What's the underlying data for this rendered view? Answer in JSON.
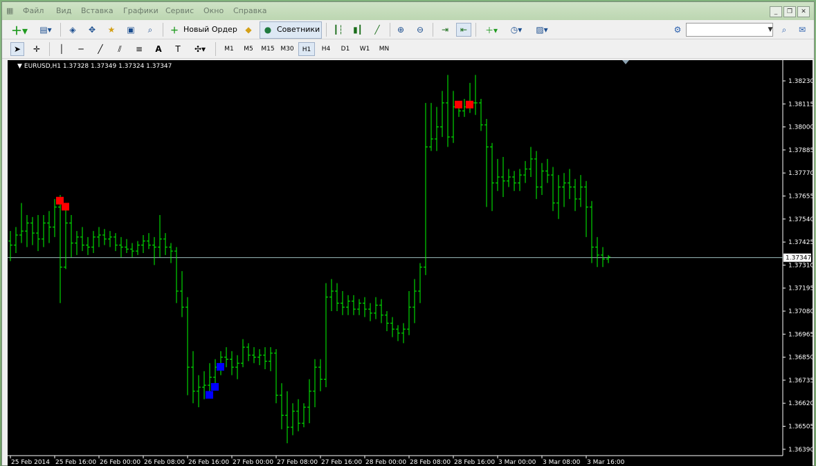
{
  "menu": [
    "Файл",
    "Вид",
    "Вставка",
    "Графики",
    "Сервис",
    "Окно",
    "Справка"
  ],
  "toolbar": {
    "new_order": "Новый Ордер",
    "experts": "Советники",
    "search_placeholder": ""
  },
  "timeframes": [
    "M1",
    "M5",
    "M15",
    "M30",
    "H1",
    "H4",
    "D1",
    "W1",
    "MN"
  ],
  "active_timeframe": "H1",
  "chart": {
    "symbol_text": "EURUSD,H1",
    "ohlc_text": "1.37328 1.37349 1.37324 1.37347",
    "current_price": "1.37347",
    "colors": {
      "bull": "#00ff00",
      "bear": "#00ff00",
      "buy_marker": "#0000ff",
      "sell_marker": "#ff0000",
      "bid_line": "#a0c0c0"
    }
  },
  "chart_data": {
    "type": "bar",
    "title": "EURUSD,H1",
    "ylim": [
      1.3633,
      1.3834
    ],
    "price_ticks": [
      "1.38230",
      "1.38115",
      "1.38000",
      "1.37885",
      "1.37770",
      "1.37655",
      "1.37540",
      "1.37425",
      "1.37310",
      "1.37195",
      "1.37080",
      "1.36965",
      "1.36850",
      "1.36735",
      "1.36620",
      "1.36505",
      "1.36390"
    ],
    "time_ticks": [
      "25 Feb 2014",
      "25 Feb 16:00",
      "26 Feb 00:00",
      "26 Feb 08:00",
      "26 Feb 16:00",
      "27 Feb 00:00",
      "27 Feb 08:00",
      "27 Feb 16:00",
      "28 Feb 00:00",
      "28 Feb 08:00",
      "28 Feb 16:00",
      "3 Mar 00:00",
      "3 Mar 08:00",
      "3 Mar 16:00"
    ],
    "bars_per_tick": 8,
    "ohlc": [
      [
        1.3743,
        1.3748,
        1.3733,
        1.3741
      ],
      [
        1.3741,
        1.375,
        1.3737,
        1.3746
      ],
      [
        1.3746,
        1.3762,
        1.3742,
        1.3748
      ],
      [
        1.3748,
        1.3756,
        1.374,
        1.3752
      ],
      [
        1.3752,
        1.3755,
        1.3741,
        1.3747
      ],
      [
        1.3747,
        1.3756,
        1.3738,
        1.3744
      ],
      [
        1.3744,
        1.3756,
        1.374,
        1.3752
      ],
      [
        1.3752,
        1.3758,
        1.3742,
        1.375
      ],
      [
        1.375,
        1.3764,
        1.3745,
        1.376
      ],
      [
        1.376,
        1.3766,
        1.3712,
        1.373
      ],
      [
        1.373,
        1.376,
        1.3729,
        1.3752
      ],
      [
        1.3752,
        1.3756,
        1.3735,
        1.3742
      ],
      [
        1.3742,
        1.3748,
        1.3736,
        1.3745
      ],
      [
        1.3745,
        1.375,
        1.3738,
        1.3741
      ],
      [
        1.3741,
        1.3745,
        1.3736,
        1.374
      ],
      [
        1.374,
        1.3748,
        1.3737,
        1.3745
      ],
      [
        1.3745,
        1.375,
        1.374,
        1.3746
      ],
      [
        1.3746,
        1.3749,
        1.3741,
        1.3744
      ],
      [
        1.3744,
        1.3748,
        1.374,
        1.3745
      ],
      [
        1.3745,
        1.3747,
        1.3738,
        1.3741
      ],
      [
        1.3741,
        1.3745,
        1.3735,
        1.374
      ],
      [
        1.374,
        1.3744,
        1.3737,
        1.3739
      ],
      [
        1.3739,
        1.3742,
        1.3735,
        1.3738
      ],
      [
        1.3738,
        1.3743,
        1.3736,
        1.3741
      ],
      [
        1.3741,
        1.3746,
        1.3737,
        1.3743
      ],
      [
        1.3743,
        1.3747,
        1.3739,
        1.3741
      ],
      [
        1.3741,
        1.3745,
        1.3731,
        1.374
      ],
      [
        1.374,
        1.3756,
        1.3735,
        1.3744
      ],
      [
        1.3744,
        1.3747,
        1.3736,
        1.374
      ],
      [
        1.374,
        1.3742,
        1.3732,
        1.3738
      ],
      [
        1.3738,
        1.374,
        1.3712,
        1.3718
      ],
      [
        1.3718,
        1.3728,
        1.3705,
        1.371
      ],
      [
        1.371,
        1.3715,
        1.3666,
        1.368
      ],
      [
        1.368,
        1.3688,
        1.3662,
        1.3668
      ],
      [
        1.3668,
        1.3676,
        1.366,
        1.367
      ],
      [
        1.367,
        1.3678,
        1.3664,
        1.3671
      ],
      [
        1.3671,
        1.3682,
        1.3666,
        1.3675
      ],
      [
        1.3675,
        1.3684,
        1.367,
        1.368
      ],
      [
        1.368,
        1.3688,
        1.3676,
        1.3685
      ],
      [
        1.3685,
        1.369,
        1.368,
        1.3684
      ],
      [
        1.3684,
        1.3688,
        1.3676,
        1.368
      ],
      [
        1.368,
        1.3686,
        1.3674,
        1.3682
      ],
      [
        1.3682,
        1.3694,
        1.368,
        1.369
      ],
      [
        1.369,
        1.3692,
        1.3683,
        1.3686
      ],
      [
        1.3686,
        1.369,
        1.3682,
        1.3685
      ],
      [
        1.3685,
        1.3689,
        1.3681,
        1.3686
      ],
      [
        1.3686,
        1.369,
        1.3679,
        1.3683
      ],
      [
        1.3683,
        1.369,
        1.3678,
        1.3687
      ],
      [
        1.3687,
        1.3689,
        1.3662,
        1.3666
      ],
      [
        1.3666,
        1.3672,
        1.3649,
        1.3656
      ],
      [
        1.3656,
        1.3668,
        1.3642,
        1.365
      ],
      [
        1.365,
        1.3662,
        1.3646,
        1.3658
      ],
      [
        1.3658,
        1.3664,
        1.3648,
        1.3652
      ],
      [
        1.3652,
        1.3662,
        1.365,
        1.366
      ],
      [
        1.366,
        1.3674,
        1.3652,
        1.3668
      ],
      [
        1.3668,
        1.3684,
        1.366,
        1.368
      ],
      [
        1.368,
        1.3684,
        1.3668,
        1.3674
      ],
      [
        1.3674,
        1.3722,
        1.367,
        1.3715
      ],
      [
        1.3715,
        1.3724,
        1.3708,
        1.3718
      ],
      [
        1.3718,
        1.3722,
        1.3708,
        1.3712
      ],
      [
        1.3712,
        1.3718,
        1.3706,
        1.371
      ],
      [
        1.371,
        1.3716,
        1.3706,
        1.3713
      ],
      [
        1.3713,
        1.3716,
        1.3706,
        1.3709
      ],
      [
        1.3709,
        1.3714,
        1.3706,
        1.3712
      ],
      [
        1.3712,
        1.3715,
        1.3705,
        1.3709
      ],
      [
        1.3709,
        1.3712,
        1.3703,
        1.3707
      ],
      [
        1.3707,
        1.3715,
        1.3704,
        1.3711
      ],
      [
        1.3711,
        1.3714,
        1.3702,
        1.3706
      ],
      [
        1.3706,
        1.3708,
        1.3698,
        1.3702
      ],
      [
        1.3702,
        1.3705,
        1.3695,
        1.3699
      ],
      [
        1.3699,
        1.3701,
        1.3693,
        1.3697
      ],
      [
        1.3697,
        1.3702,
        1.3692,
        1.3699
      ],
      [
        1.3699,
        1.3718,
        1.3696,
        1.371
      ],
      [
        1.371,
        1.3724,
        1.3702,
        1.3718
      ],
      [
        1.3718,
        1.3732,
        1.3712,
        1.373
      ],
      [
        1.373,
        1.3812,
        1.3726,
        1.379
      ],
      [
        1.379,
        1.3812,
        1.3788,
        1.3794
      ],
      [
        1.3794,
        1.381,
        1.3788,
        1.38
      ],
      [
        1.38,
        1.3818,
        1.3795,
        1.3812
      ],
      [
        1.3812,
        1.3826,
        1.379,
        1.3795
      ],
      [
        1.3795,
        1.3818,
        1.3792,
        1.381
      ],
      [
        1.381,
        1.3813,
        1.3805,
        1.3808
      ],
      [
        1.3808,
        1.3814,
        1.3805,
        1.381
      ],
      [
        1.381,
        1.3822,
        1.3807,
        1.3812
      ],
      [
        1.3812,
        1.3826,
        1.3806,
        1.3812
      ],
      [
        1.3812,
        1.3814,
        1.3798,
        1.3801
      ],
      [
        1.3801,
        1.3804,
        1.376,
        1.379
      ],
      [
        1.379,
        1.3792,
        1.3758,
        1.3772
      ],
      [
        1.3772,
        1.3784,
        1.3768,
        1.3775
      ],
      [
        1.3775,
        1.3785,
        1.3765,
        1.3773
      ],
      [
        1.3773,
        1.3779,
        1.377,
        1.3775
      ],
      [
        1.3775,
        1.3778,
        1.3768,
        1.3772
      ],
      [
        1.3772,
        1.3779,
        1.3768,
        1.3776
      ],
      [
        1.3776,
        1.3783,
        1.3772,
        1.3779
      ],
      [
        1.3779,
        1.379,
        1.3775,
        1.3784
      ],
      [
        1.3784,
        1.3788,
        1.3764,
        1.377
      ],
      [
        1.377,
        1.3782,
        1.3766,
        1.3778
      ],
      [
        1.3778,
        1.3784,
        1.3772,
        1.3776
      ],
      [
        1.3776,
        1.378,
        1.3758,
        1.3762
      ],
      [
        1.3762,
        1.3776,
        1.3754,
        1.377
      ],
      [
        1.377,
        1.3777,
        1.376,
        1.3772
      ],
      [
        1.3772,
        1.3779,
        1.3764,
        1.377
      ],
      [
        1.377,
        1.3774,
        1.3758,
        1.3764
      ],
      [
        1.3764,
        1.3776,
        1.376,
        1.377
      ],
      [
        1.377,
        1.3773,
        1.3745,
        1.376
      ],
      [
        1.376,
        1.3763,
        1.3732,
        1.374
      ],
      [
        1.374,
        1.3745,
        1.373,
        1.3736
      ],
      [
        1.3736,
        1.374,
        1.373,
        1.3734
      ],
      [
        1.3734,
        1.3736,
        1.3732,
        1.3735
      ]
    ],
    "buy_markers": [
      [
        36,
        1.3666
      ],
      [
        37,
        1.367
      ],
      [
        38,
        1.368
      ]
    ],
    "sell_markers": [
      [
        9,
        1.3763
      ],
      [
        10,
        1.376
      ],
      [
        81,
        1.3811
      ],
      [
        83,
        1.3811
      ]
    ]
  }
}
